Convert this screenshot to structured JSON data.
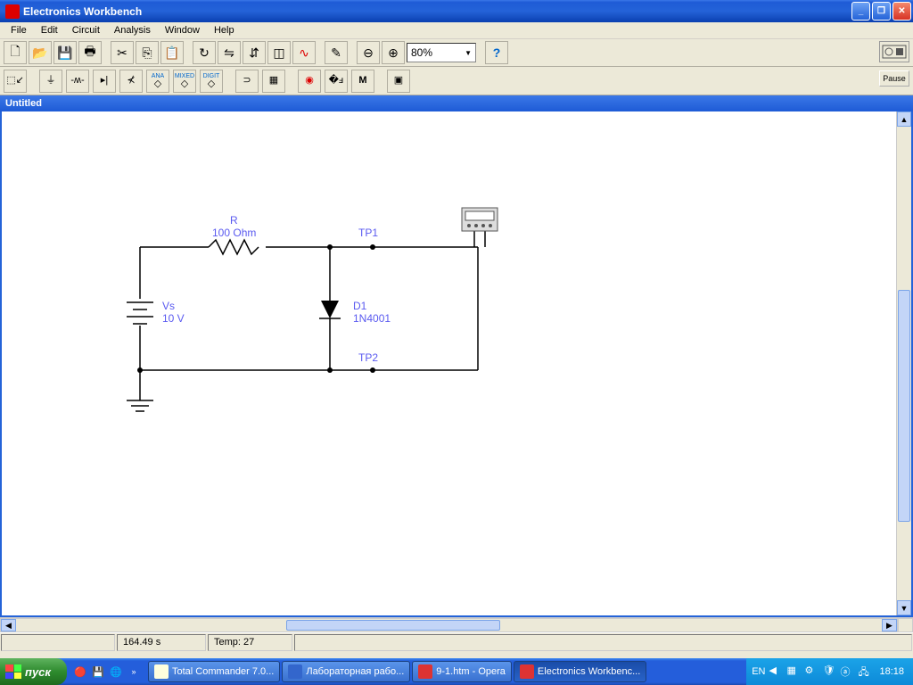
{
  "titlebar": {
    "title": "Electronics Workbench"
  },
  "menu": {
    "file": "File",
    "edit": "Edit",
    "circuit": "Circuit",
    "analysis": "Analysis",
    "window": "Window",
    "help": "Help"
  },
  "toolbar": {
    "zoom": "80%",
    "help": "?",
    "pause": "Pause"
  },
  "document": {
    "title": "Untitled"
  },
  "circuit": {
    "vs_name": "Vs",
    "vs_value": "10 V",
    "r_name": "R",
    "r_value": "100  Ohm",
    "d_name": "D1",
    "d_value": "1N4001",
    "tp1": "TP1",
    "tp2": "TP2"
  },
  "status": {
    "time": "164.49 s",
    "temp": "Temp:  27"
  },
  "taskbar": {
    "start": "пуск",
    "tasks": [
      "Total Commander 7.0...",
      "Лабораторная рабо...",
      "9-1.htm - Opera",
      "Electronics Workbenc..."
    ],
    "lang": "EN",
    "clock": "18:18"
  }
}
